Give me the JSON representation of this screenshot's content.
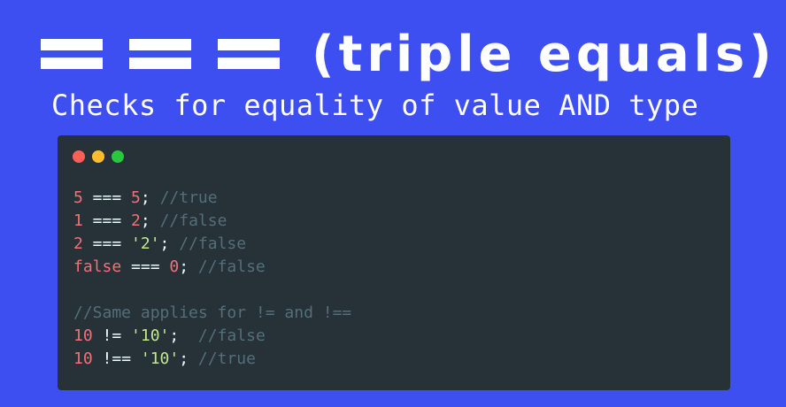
{
  "header": {
    "title": "(triple equals)",
    "glyph_count": 3,
    "subtitle": "Checks for equality of value AND type"
  },
  "window": {
    "dots": [
      {
        "name": "close",
        "color": "#ff5f56"
      },
      {
        "name": "minimize",
        "color": "#ffbd2e"
      },
      {
        "name": "maximize",
        "color": "#27c93f"
      }
    ]
  },
  "code": {
    "lines": [
      [
        {
          "t": "num",
          "v": "5"
        },
        {
          "t": "op",
          "v": " === "
        },
        {
          "t": "num",
          "v": "5"
        },
        {
          "t": "op",
          "v": "; "
        },
        {
          "t": "cmt",
          "v": "//true"
        }
      ],
      [
        {
          "t": "num",
          "v": "1"
        },
        {
          "t": "op",
          "v": " === "
        },
        {
          "t": "num",
          "v": "2"
        },
        {
          "t": "op",
          "v": "; "
        },
        {
          "t": "cmt",
          "v": "//false"
        }
      ],
      [
        {
          "t": "num",
          "v": "2"
        },
        {
          "t": "op",
          "v": " === "
        },
        {
          "t": "str",
          "v": "'2'"
        },
        {
          "t": "op",
          "v": "; "
        },
        {
          "t": "cmt",
          "v": "//false"
        }
      ],
      [
        {
          "t": "num",
          "v": "false"
        },
        {
          "t": "op",
          "v": " === "
        },
        {
          "t": "num",
          "v": "0"
        },
        {
          "t": "op",
          "v": "; "
        },
        {
          "t": "cmt",
          "v": "//false"
        }
      ],
      [],
      [
        {
          "t": "cmt",
          "v": "//Same applies for != and !=="
        }
      ],
      [
        {
          "t": "num",
          "v": "10"
        },
        {
          "t": "op",
          "v": " != "
        },
        {
          "t": "str",
          "v": "'10'"
        },
        {
          "t": "op",
          "v": ";  "
        },
        {
          "t": "cmt",
          "v": "//false"
        }
      ],
      [
        {
          "t": "num",
          "v": "10"
        },
        {
          "t": "op",
          "v": " !== "
        },
        {
          "t": "str",
          "v": "'10'"
        },
        {
          "t": "op",
          "v": "; "
        },
        {
          "t": "cmt",
          "v": "//true"
        }
      ]
    ]
  },
  "colors": {
    "background": "#3e4ff1",
    "code_background": "#263238",
    "number": "#f07178",
    "string": "#c3e88d",
    "comment": "#546e7a",
    "operator": "#eeffff"
  }
}
